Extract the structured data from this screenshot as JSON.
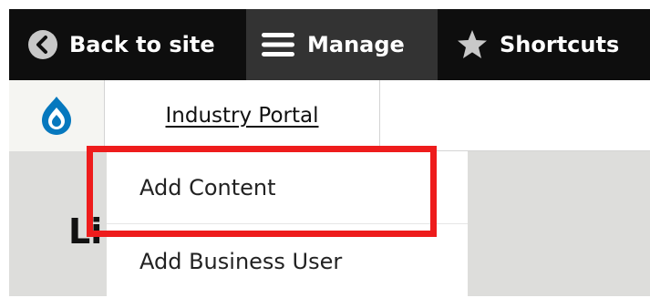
{
  "toolbar": {
    "back_label": "Back to site",
    "manage_label": "Manage",
    "shortcuts_label": "Shortcuts"
  },
  "tray": {
    "portal_link": "Industry Portal"
  },
  "page": {
    "heading_partial": "Li"
  },
  "dropdown": {
    "items": [
      {
        "label": "Add Content"
      },
      {
        "label": "Add Business User"
      }
    ]
  },
  "colors": {
    "toolbar_bg": "#0e0e0e",
    "manage_active_bg": "#333333",
    "drupal_blue": "#0678be",
    "highlight_red": "#ee1c1c",
    "page_grey": "#dddddb"
  },
  "icons": {
    "back": "chevron-left-circle-icon",
    "manage": "hamburger-menu-icon",
    "shortcuts": "star-icon",
    "logo": "drupal-drop-logo"
  }
}
